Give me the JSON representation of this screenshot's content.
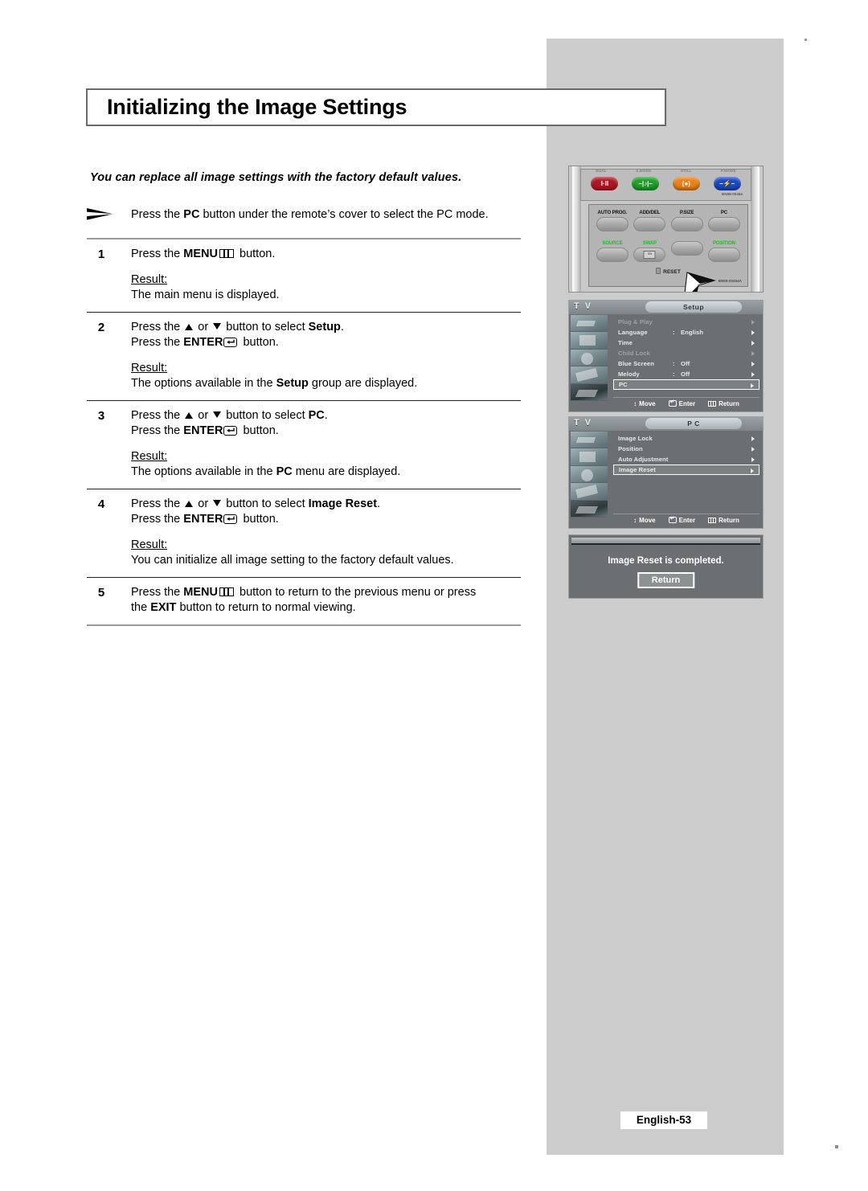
{
  "page": {
    "title": "Initializing the Image Settings",
    "footer_label": "English-53"
  },
  "intro": {
    "note": "You can replace all image settings with the factory default values.",
    "bullet": "Press the PC button under the remote’s cover to select the PC mode.",
    "bullet_pre": "Press the ",
    "bullet_bold": "PC",
    "bullet_post": " button under the remote’s cover to select the PC mode."
  },
  "steps": [
    {
      "number": "1",
      "action_pre": "Press the ",
      "action_bold": "MENU",
      "action_post": " button.",
      "result_label": "Result:",
      "result_text": "The main menu is displayed."
    },
    {
      "number": "2",
      "line1_pre": "Press the ",
      "line1_mid": " or ",
      "line1_post": " button to select ",
      "line1_bold": "Setup",
      "line1_end": ".",
      "line2_pre": "Press the ",
      "line2_bold": "ENTER",
      "line2_post": " button.",
      "result_label": "Result:",
      "result_pre": "The options available in the ",
      "result_bold": "Setup",
      "result_post": " group are displayed."
    },
    {
      "number": "3",
      "line1_pre": "Press the ",
      "line1_mid": " or ",
      "line1_post": " button to select ",
      "line1_bold": "PC",
      "line1_end": ".",
      "line2_pre": "Press the ",
      "line2_bold": "ENTER",
      "line2_post": " button.",
      "result_label": "Result:",
      "result_pre": "The options available in the ",
      "result_bold": "PC",
      "result_post": " menu are displayed."
    },
    {
      "number": "4",
      "line1_pre": "Press the ",
      "line1_mid": " or ",
      "line1_post": " button to select ",
      "line1_bold": "Image Reset",
      "line1_end": ".",
      "line2_pre": "Press the ",
      "line2_bold": "ENTER",
      "line2_post": " button.",
      "result_label": "Result:",
      "result_text": "You can initialize all image setting to the factory default values."
    },
    {
      "number": "5",
      "line1_pre": "Press the ",
      "line1_bold": "MENU",
      "line1_post": " button to return to the previous menu or press",
      "line2_pre": "the ",
      "line2_bold": "EXIT",
      "line2_post": " button to return to normal viewing."
    }
  ],
  "remote": {
    "color_buttons": [
      {
        "label": "I·II",
        "color": "#b01722"
      },
      {
        "label": "–|♪|–",
        "color": "#1fa028"
      },
      {
        "label": "(●)",
        "color": "#e8821a"
      },
      {
        "label": "–⚡–",
        "color": "#1a49c4"
      }
    ],
    "color_labels": [
      "DUAL",
      "S.MODE",
      "STILL",
      "P.MODE"
    ],
    "code_top": "BN59-00454",
    "code_bottom": "BN59-00454A",
    "top_row": [
      "AUTO PROG.",
      "ADD/DEL",
      "P.SIZE",
      "PC"
    ],
    "bottom_row": [
      "SOURCE",
      "SWAP",
      "",
      "POSITION"
    ],
    "bottom_row_icon": "SB",
    "reset_label": "RESET"
  },
  "osd_setup": {
    "tv_tag": "T V",
    "tab": "Setup",
    "items": [
      {
        "label": "Plug & Play",
        "value": "",
        "state": "dim"
      },
      {
        "label": "Language",
        "value": "English",
        "state": "normal"
      },
      {
        "label": "Time",
        "value": "",
        "state": "normal"
      },
      {
        "label": "Child Lock",
        "value": "",
        "state": "dim"
      },
      {
        "label": "Blue Screen",
        "value": "Off",
        "state": "normal"
      },
      {
        "label": "Melody",
        "value": "Off",
        "state": "normal"
      },
      {
        "label": "PC",
        "value": "",
        "state": "selected"
      }
    ],
    "footer": {
      "move": "Move",
      "enter": "Enter",
      "return": "Return"
    }
  },
  "osd_pc": {
    "tv_tag": "T V",
    "tab": "P C",
    "items": [
      {
        "label": "Image Lock",
        "value": "",
        "state": "normal"
      },
      {
        "label": "Position",
        "value": "",
        "state": "normal"
      },
      {
        "label": "Auto Adjustment",
        "value": "",
        "state": "normal"
      },
      {
        "label": "Image Reset",
        "value": "",
        "state": "selected"
      }
    ],
    "footer": {
      "move": "Move",
      "enter": "Enter",
      "return": "Return"
    }
  },
  "confirm_dialog": {
    "message": "Image Reset is completed.",
    "button": "Return"
  }
}
